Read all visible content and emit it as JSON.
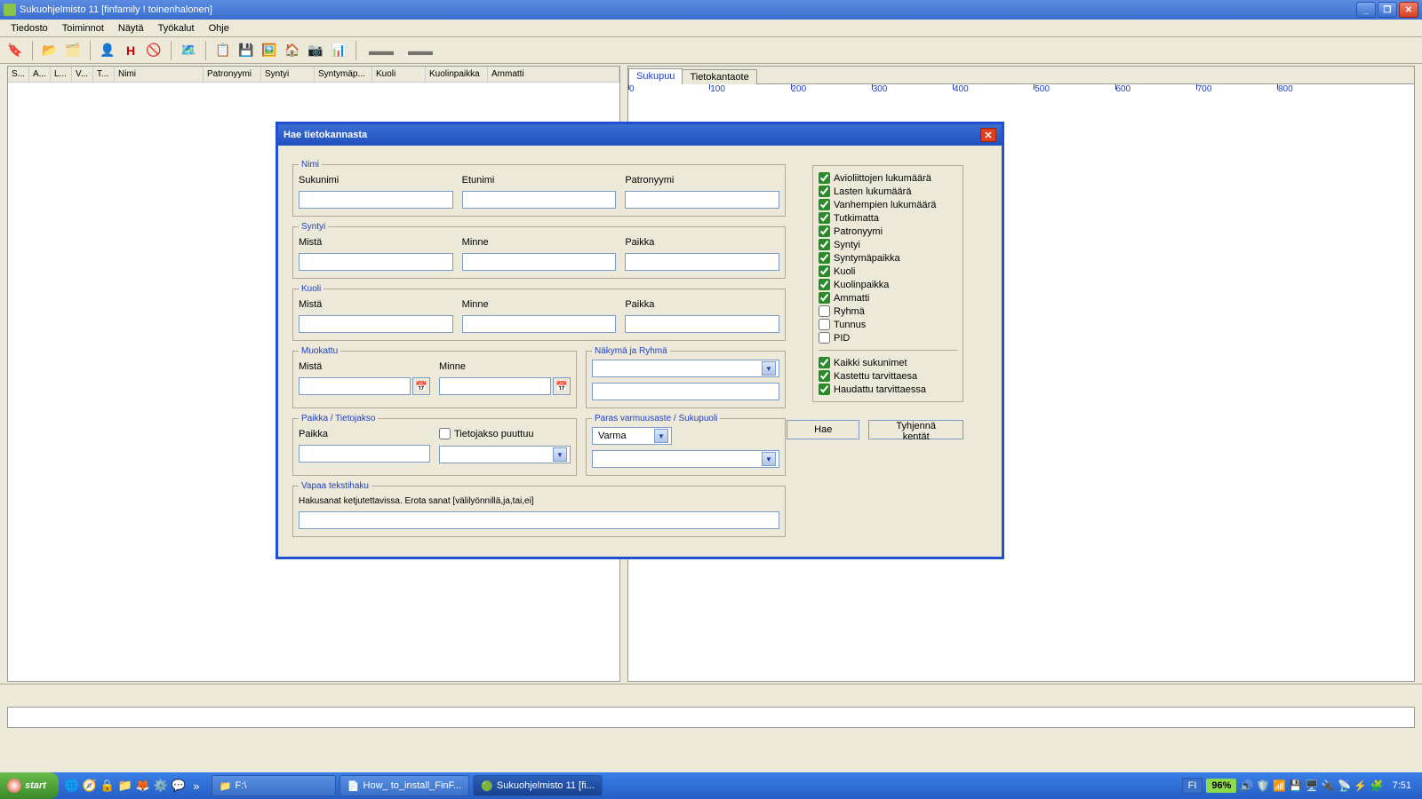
{
  "window": {
    "title": "Sukuohjelmisto 11 [finfamily ! toinenhalonen]"
  },
  "menu": [
    "Tiedosto",
    "Toiminnot",
    "Näytä",
    "Työkalut",
    "Ohje"
  ],
  "table_headers": {
    "s": "S...",
    "a": "A...",
    "l": "L...",
    "v": "V...",
    "t": "T...",
    "nimi": "Nimi",
    "patro": "Patronyymi",
    "syntyi": "Syntyi",
    "syntymap": "Syntymäp...",
    "kuoli": "Kuoli",
    "kuolinp": "Kuolinpaikka",
    "ammatti": "Ammatti"
  },
  "righttabs": {
    "active": "Sukupuu",
    "other": "Tietokantaote"
  },
  "ruler_ticks": [
    "0",
    "100",
    "200",
    "300",
    "400",
    "500",
    "600",
    "700",
    "800"
  ],
  "dialog": {
    "title": "Hae tietokannasta",
    "sections": {
      "nimi": {
        "legend": "Nimi",
        "f1": "Sukunimi",
        "f2": "Etunimi",
        "f3": "Patronyymi"
      },
      "syntyi": {
        "legend": "Syntyi",
        "f1": "Mistä",
        "f2": "Minne",
        "f3": "Paikka"
      },
      "kuoli": {
        "legend": "Kuoli",
        "f1": "Mistä",
        "f2": "Minne",
        "f3": "Paikka"
      },
      "muokattu": {
        "legend": "Muokattu",
        "f1": "Mistä",
        "f2": "Minne"
      },
      "nakyma": {
        "legend": "Näkymä ja Ryhmä"
      },
      "paikka": {
        "legend": "Paikka / Tietojakso",
        "f1": "Paikka",
        "chk": "Tietojakso puuttuu"
      },
      "varmuus": {
        "legend": "Paras varmuusaste / Sukupuoli",
        "value": "Varma"
      },
      "vapaa": {
        "legend": "Vapaa tekstihaku",
        "help": "Hakusanat ketjutettavissa. Erota sanat [välilyönnillä,ja,tai,ei]"
      }
    },
    "checks": [
      {
        "label": "Avioliittojen lukumäärä",
        "checked": true
      },
      {
        "label": "Lasten lukumäärä",
        "checked": true
      },
      {
        "label": "Vanhempien lukumäärä",
        "checked": true
      },
      {
        "label": "Tutkimatta",
        "checked": true
      },
      {
        "label": "Patronyymi",
        "checked": true
      },
      {
        "label": "Syntyi",
        "checked": true
      },
      {
        "label": "Syntymäpaikka",
        "checked": true
      },
      {
        "label": "Kuoli",
        "checked": true
      },
      {
        "label": "Kuolinpaikka",
        "checked": true
      },
      {
        "label": "Ammatti",
        "checked": true
      },
      {
        "label": "Ryhmä",
        "checked": false
      },
      {
        "label": "Tunnus",
        "checked": false
      },
      {
        "label": "PID",
        "checked": false
      }
    ],
    "checks2": [
      {
        "label": "Kaikki sukunimet",
        "checked": true
      },
      {
        "label": "Kastettu tarvittaesa",
        "checked": true
      },
      {
        "label": "Haudattu tarvittaessa",
        "checked": true
      }
    ],
    "buttons": {
      "search": "Hae",
      "clear": "Tyhjennä kentät"
    }
  },
  "taskbar": {
    "start": "start",
    "tasks": [
      {
        "label": "F:\\",
        "icon": "📁"
      },
      {
        "label": "How_ to_install_FinF...",
        "icon": "📄"
      },
      {
        "label": "Sukuohjelmisto 11 [fi...",
        "icon": "🟢",
        "active": true
      }
    ],
    "lang": "FI",
    "battery": "96%",
    "clock": "7:51"
  }
}
